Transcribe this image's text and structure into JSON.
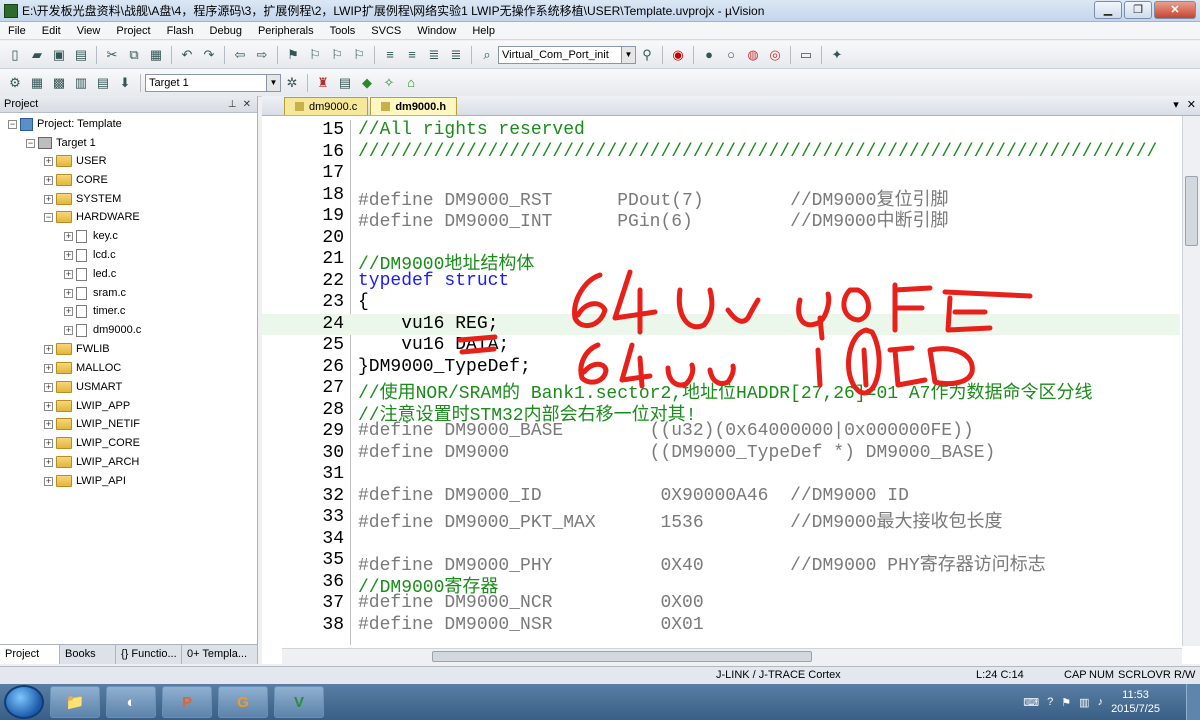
{
  "window": {
    "title": "E:\\开发板光盘资料\\战舰\\A盘\\4，程序源码\\3，扩展例程\\2，LWIP扩展例程\\网络实验1 LWIP无操作系统移植\\USER\\Template.uvprojx - µVision"
  },
  "menu": [
    "File",
    "Edit",
    "View",
    "Project",
    "Flash",
    "Debug",
    "Peripherals",
    "Tools",
    "SVCS",
    "Window",
    "Help"
  ],
  "toolbar": {
    "combo_target": "Virtual_Com_Port_init",
    "build_target": "Target 1"
  },
  "project_panel": {
    "title": "Project",
    "root": "Project: Template",
    "target": "Target 1",
    "groups": [
      "USER",
      "CORE",
      "SYSTEM",
      "HARDWARE"
    ],
    "hardware_files": [
      "key.c",
      "lcd.c",
      "led.c",
      "sram.c",
      "timer.c",
      "dm9000.c"
    ],
    "more_groups": [
      "FWLIB",
      "MALLOC",
      "USMART",
      "LWIP_APP",
      "LWIP_NETIF",
      "LWIP_CORE",
      "LWIP_ARCH",
      "LWIP_API"
    ],
    "tabs": [
      "Project",
      "Books",
      "{} Functio...",
      "0+ Templa..."
    ]
  },
  "editor": {
    "tabs": [
      "dm9000.c",
      "dm9000.h"
    ],
    "active_tab": "dm9000.h",
    "lines": [
      {
        "n": "15",
        "t": "//All rights reserved",
        "c": "cm"
      },
      {
        "n": "16",
        "t": "//////////////////////////////////////////////////////////////////////////",
        "c": "cm"
      },
      {
        "n": "17",
        "t": "",
        "c": "tx"
      },
      {
        "n": "18",
        "t": "#define DM9000_RST      PDout(7)        //DM9000复位引脚",
        "c": "pp"
      },
      {
        "n": "19",
        "t": "#define DM9000_INT      PGin(6)         //DM9000中断引脚",
        "c": "pp"
      },
      {
        "n": "20",
        "t": "",
        "c": "tx"
      },
      {
        "n": "21",
        "t": "//DM9000地址结构体",
        "c": "cm"
      },
      {
        "n": "22",
        "t": "typedef struct",
        "c": "kw"
      },
      {
        "n": "23",
        "t": "{",
        "c": "tx"
      },
      {
        "n": "24",
        "t": "    vu16 REG;",
        "c": "tx"
      },
      {
        "n": "25",
        "t": "    vu16 DATA;",
        "c": "tx"
      },
      {
        "n": "26",
        "t": "}DM9000_TypeDef;",
        "c": "tx"
      },
      {
        "n": "27",
        "t": "//使用NOR/SRAM的 Bank1.sector2,地址位HADDR[27,26]=01 A7作为数据命令区分线",
        "c": "cm"
      },
      {
        "n": "28",
        "t": "//注意设置时STM32内部会右移一位对其!",
        "c": "cm"
      },
      {
        "n": "29",
        "t": "#define DM9000_BASE        ((u32)(0x64000000|0x000000FE))",
        "c": "pp"
      },
      {
        "n": "30",
        "t": "#define DM9000             ((DM9000_TypeDef *) DM9000_BASE)",
        "c": "pp"
      },
      {
        "n": "31",
        "t": "",
        "c": "tx"
      },
      {
        "n": "32",
        "t": "#define DM9000_ID           0X90000A46  //DM9000 ID",
        "c": "pp"
      },
      {
        "n": "33",
        "t": "#define DM9000_PKT_MAX      1536        //DM9000最大接收包长度",
        "c": "pp"
      },
      {
        "n": "34",
        "t": "",
        "c": "tx"
      },
      {
        "n": "35",
        "t": "#define DM9000_PHY          0X40        //DM9000 PHY寄存器访问标志",
        "c": "pp"
      },
      {
        "n": "36",
        "t": "//DM9000寄存器",
        "c": "cm"
      },
      {
        "n": "37",
        "t": "#define DM9000_NCR          0X00",
        "c": "pp"
      },
      {
        "n": "38",
        "t": "#define DM9000_NSR          0X01",
        "c": "pp"
      }
    ],
    "highlight_line": "24"
  },
  "status": {
    "debugger": "J-LINK / J-TRACE Cortex",
    "position": "L:24 C:14",
    "cap": "CAP",
    "num": "NUM",
    "scrl": "SCRL",
    "ovr": "OVR",
    "rw": "R/W"
  },
  "taskbar": {
    "time": "11:53",
    "date": "2015/7/25",
    "apps": [
      "📁",
      "◐",
      "P",
      "G",
      "V"
    ]
  },
  "colors": {
    "comment": "#1a8c1a",
    "keyword": "#1a1aff",
    "ink": "#e8201a"
  }
}
